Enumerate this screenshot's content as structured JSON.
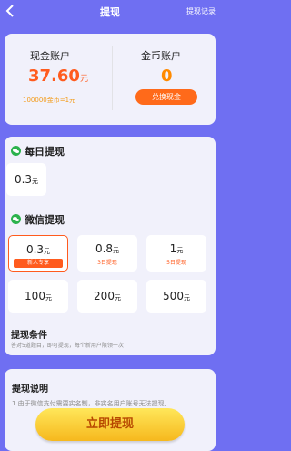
{
  "header": {
    "title": "提现",
    "record_link": "提现记录"
  },
  "accounts": {
    "cash": {
      "label": "现金账户",
      "amount": "37.60",
      "unit": "元",
      "rate_note": "100000金币=1元"
    },
    "coin": {
      "label": "金币账户",
      "amount": "0",
      "exchange_label": "兑换现金"
    }
  },
  "daily": {
    "title": "每日提现",
    "option": {
      "amount": "0.3",
      "unit": "元"
    }
  },
  "wechat": {
    "title": "微信提现",
    "options": [
      {
        "amount": "0.3",
        "unit": "元",
        "tag": "新人专享",
        "selected": true
      },
      {
        "amount": "0.8",
        "unit": "元",
        "tag": "3日提现"
      },
      {
        "amount": "1",
        "unit": "元",
        "tag": "5日提现"
      },
      {
        "amount": "100",
        "unit": "元"
      },
      {
        "amount": "200",
        "unit": "元"
      },
      {
        "amount": "500",
        "unit": "元"
      }
    ]
  },
  "conditions": {
    "title": "提现条件",
    "text": "答对5道题目，即可提现，每个新用户限领一次"
  },
  "instructions": {
    "title": "提现说明",
    "text": "1.由于微信支付需要实名制，非实名用户账号无法提现,"
  },
  "withdraw_button": {
    "label": "立即提现"
  },
  "colors": {
    "background": "#6f6ff2",
    "accent": "#ff5b1e",
    "coin": "#ff8a00",
    "wechat_green": "#2bb24c"
  }
}
